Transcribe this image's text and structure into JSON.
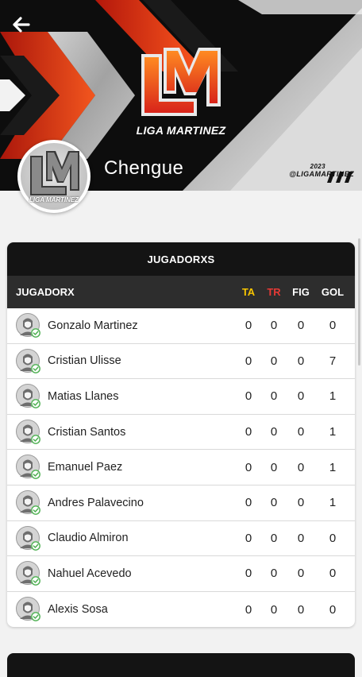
{
  "banner": {
    "logo_text": "LIGA MARTINEZ",
    "handle": "@LIGAMARTINEZ",
    "year": "2023",
    "team_name": "Chengue",
    "avatar_caption": "LIGA MARTINEZ"
  },
  "table": {
    "title": "JUGADORXS",
    "headers": {
      "player": "JUGADORX",
      "ta": "TA",
      "tr": "TR",
      "fig": "FIG",
      "gol": "GOL"
    },
    "header_colors": {
      "ta": "#f7c400",
      "tr": "#e53935"
    },
    "rows": [
      {
        "name": "Gonzalo Martinez",
        "ta": "0",
        "tr": "0",
        "fig": "0",
        "gol": "0"
      },
      {
        "name": "Cristian Ulisse",
        "ta": "0",
        "tr": "0",
        "fig": "0",
        "gol": "7"
      },
      {
        "name": "Matias Llanes",
        "ta": "0",
        "tr": "0",
        "fig": "0",
        "gol": "1"
      },
      {
        "name": "Cristian Santos",
        "ta": "0",
        "tr": "0",
        "fig": "0",
        "gol": "1"
      },
      {
        "name": "Emanuel Paez",
        "ta": "0",
        "tr": "0",
        "fig": "0",
        "gol": "1"
      },
      {
        "name": "Andres Palavecino",
        "ta": "0",
        "tr": "0",
        "fig": "0",
        "gol": "1"
      },
      {
        "name": "Claudio Almiron",
        "ta": "0",
        "tr": "0",
        "fig": "0",
        "gol": "0"
      },
      {
        "name": "Nahuel Acevedo",
        "ta": "0",
        "tr": "0",
        "fig": "0",
        "gol": "0"
      },
      {
        "name": "Alexis Sosa",
        "ta": "0",
        "tr": "0",
        "fig": "0",
        "gol": "0"
      }
    ]
  },
  "icons": {
    "back": "arrow-left-icon",
    "player_avatar": "user-avatar-icon",
    "verified": "check-circle-icon"
  },
  "colors": {
    "brand_red": "#e0301e",
    "brand_orange": "#f47a20",
    "dark": "#141414"
  }
}
